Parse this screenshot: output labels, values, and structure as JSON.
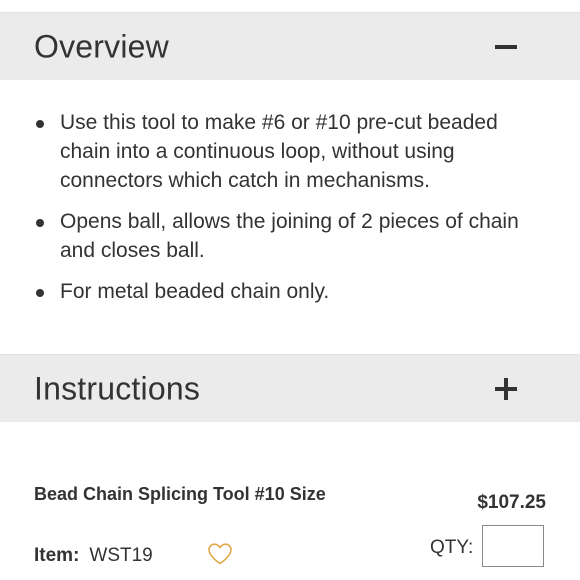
{
  "overview": {
    "title": "Overview",
    "toggle_icon": "minus-icon",
    "bullets": [
      "Use this tool to make #6 or #10 pre-cut beaded chain into a continuous loop, without using connectors which catch in mechanisms.",
      "Opens ball, allows the joining of 2 pieces of chain and closes ball.",
      "For metal beaded chain only."
    ]
  },
  "instructions": {
    "title": "Instructions",
    "toggle_icon": "plus-icon"
  },
  "product": {
    "name": "Bead Chain Splicing Tool #10 Size",
    "item_label": "Item:",
    "item_number": "WST19",
    "price": "$107.25",
    "qty_label": "QTY:",
    "qty_value": "",
    "wishlist_icon": "heart-icon",
    "wishlist_color": "#e0a84a"
  },
  "colors": {
    "header_bg": "#ebebeb",
    "text": "#333333"
  }
}
